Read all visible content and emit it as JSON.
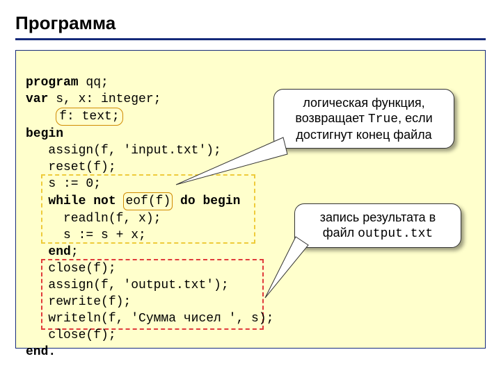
{
  "title": "Программа",
  "code": {
    "l1a": "program",
    "l1b": " qq;",
    "l2a": "var",
    "l2b": " s, x: integer;",
    "l3a": "    ",
    "l3b": "f: text;",
    "l4": "begin",
    "l5": "   assign(f, 'input.txt');",
    "l6": "   reset(f);",
    "l7": "   s := 0;",
    "l8a": "   ",
    "l8b": "while not ",
    "l8c": "eof(f)",
    "l8d": " do begin",
    "l9": "     readln(f, x);",
    "l10": "     s := s + x;",
    "l11a": "   ",
    "l11b": "end",
    "l11c": ";",
    "l12": "   close(f);",
    "l13": "   assign(f, 'output.txt');",
    "l14": "   rewrite(f);",
    "l15": "   writeln(f, 'Сумма чисел ', s);",
    "l16": "   close(f);",
    "l17": "end."
  },
  "callout1": {
    "line1": "логическая функция,",
    "line2a": "возвращает ",
    "line2b": "True",
    "line2c": ", если",
    "line3": "достигнут конец файла"
  },
  "callout2": {
    "line1": "запись результата в",
    "line2a": "файл ",
    "line2b": "output.txt"
  }
}
